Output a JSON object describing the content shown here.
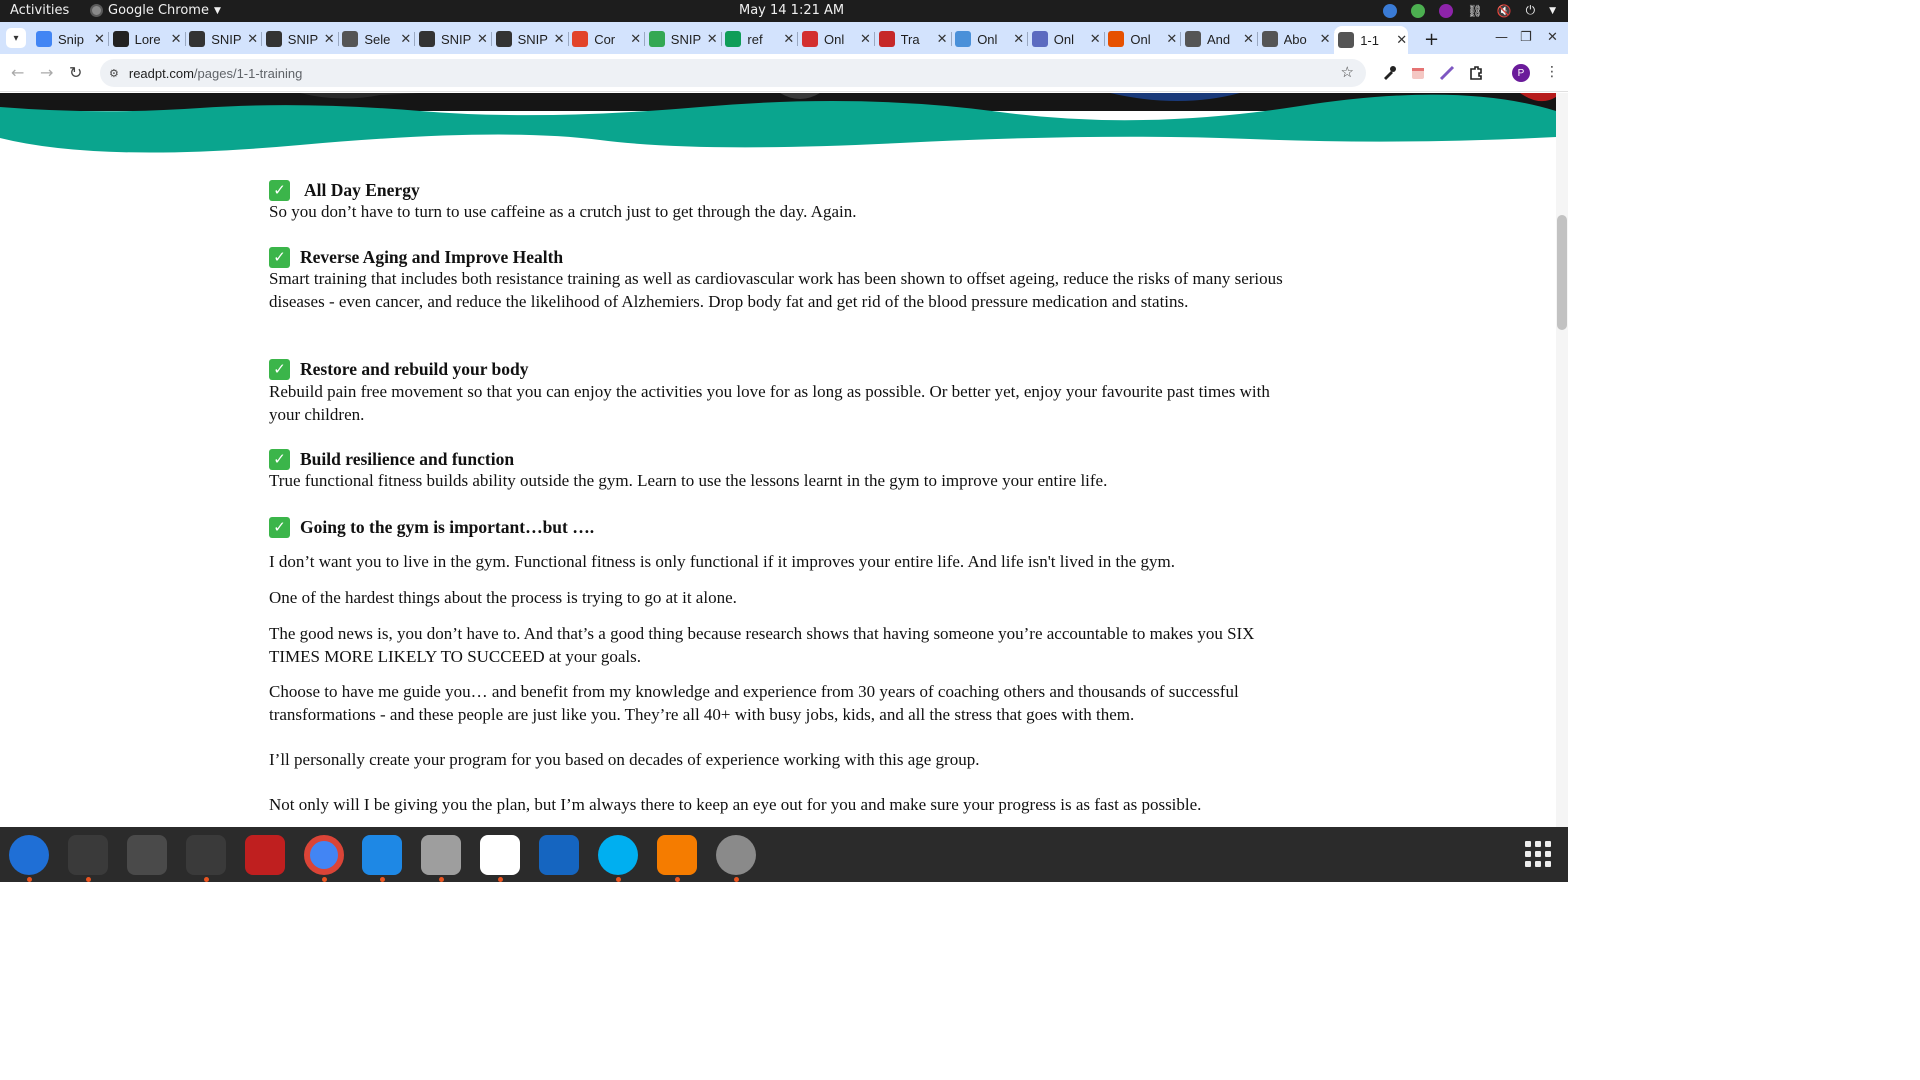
{
  "system_bar": {
    "activities": "Activities",
    "app_name": "Google Chrome",
    "clock": "May 14  1:21 AM"
  },
  "tabs": [
    {
      "title": "Snip",
      "favicon": "google-docs-icon",
      "color": "#4285f4"
    },
    {
      "title": "Lore",
      "favicon": "letter-l-icon",
      "color": "#222222"
    },
    {
      "title": "SNIP",
      "favicon": "snip-logo-icon",
      "color": "#333333"
    },
    {
      "title": "SNIP",
      "favicon": "snip-logo-icon",
      "color": "#333333"
    },
    {
      "title": "Sele",
      "favicon": "globe-icon",
      "color": "#555555"
    },
    {
      "title": "SNIP",
      "favicon": "snip-logo-icon",
      "color": "#333333"
    },
    {
      "title": "SNIP",
      "favicon": "snip-logo-icon",
      "color": "#333333"
    },
    {
      "title": "Cor",
      "favicon": "gitlab-icon",
      "color": "#e24329"
    },
    {
      "title": "SNIP",
      "favicon": "colorful-logo-icon",
      "color": "#34a853"
    },
    {
      "title": "ref",
      "favicon": "plus-sheet-icon",
      "color": "#0f9d58"
    },
    {
      "title": "Onl",
      "favicon": "red-logo-icon",
      "color": "#d32f2f"
    },
    {
      "title": "Tra",
      "favicon": "red-logo-icon",
      "color": "#c62828"
    },
    {
      "title": "Onl",
      "favicon": "w-logo-icon",
      "color": "#4a90d9"
    },
    {
      "title": "Onl",
      "favicon": "feather-logo-icon",
      "color": "#5c6bc0"
    },
    {
      "title": "Onl",
      "favicon": "chevron-logo-icon",
      "color": "#e65100"
    },
    {
      "title": "And",
      "favicon": "globe-icon",
      "color": "#555555"
    },
    {
      "title": "Abo",
      "favicon": "globe-icon",
      "color": "#555555"
    },
    {
      "title": "1-1",
      "favicon": "globe-icon",
      "color": "#555555",
      "active": true
    }
  ],
  "toolbar": {
    "url_host": "readpt.com",
    "url_path": "/pages/1-1-training",
    "avatar_letter": "P"
  },
  "page": {
    "accent_color": "#0aa58e",
    "features": [
      {
        "title": "All Day Energy",
        "body": "So you don’t have to turn to use caffeine as a crutch just to get through the day. Again."
      },
      {
        "title": "Reverse Aging and Improve Health",
        "body": "Smart training that includes both resistance training as well as cardiovascular work has been shown to offset ageing, reduce the risks of many serious diseases  - even cancer, and reduce the likelihood of Alzhemiers. Drop body fat and get rid of the blood pressure medication and statins."
      },
      {
        "title": "Restore and rebuild your body",
        "body": "Rebuild pain free movement so that you can enjoy the activities you love for as long as possible. Or better yet, enjoy your favourite past times with your children."
      },
      {
        "title": "Build resilience and function",
        "body": "True functional fitness builds ability outside the gym. Learn to use the lessons learnt in the gym to improve your entire life."
      },
      {
        "title": "Going to the gym is important…but ….",
        "body": ""
      }
    ],
    "paragraphs": [
      "I don’t want you to live in the gym. Functional fitness is only functional if it improves your entire life. And life isn't lived in the gym.",
      "One of the hardest things about the process is trying to go at it alone.",
      "The good news is, you don’t have to. And that’s a good thing because research shows that having someone you’re accountable to makes you SIX TIMES MORE LIKELY TO SUCCEED at your goals.",
      "Choose to have me guide you… and benefit from my knowledge and experience from 30 years of coaching others and thousands of successful transformations - and these people are just like you. They’re all 40+ with busy jobs, kids, and all the stress that goes with them.",
      "I’ll personally create your program for you based on decades of experience working with this age group.",
      "Not only will I be giving you the plan, but I’m always there to keep an eye out for you and make sure your progress is as fast as possible."
    ]
  },
  "dock": [
    {
      "name": "thunderbird-icon",
      "color": "#1f6fd6"
    },
    {
      "name": "terminal-icon",
      "color": "#3a3a3a"
    },
    {
      "name": "calculator-icon",
      "color": "#4a4a4a"
    },
    {
      "name": "system-monitor-icon",
      "color": "#3a3a3a"
    },
    {
      "name": "filezilla-icon",
      "color": "#bf1f1f"
    },
    {
      "name": "chrome-icon",
      "color": "#4285f4"
    },
    {
      "name": "vscode-icon",
      "color": "#1e88e5"
    },
    {
      "name": "files-icon",
      "color": "#9e9e9e"
    },
    {
      "name": "text-editor-icon",
      "color": "#ffffff"
    },
    {
      "name": "libreoffice-writer-icon",
      "color": "#1565c0"
    },
    {
      "name": "skype-icon",
      "color": "#00aff0"
    },
    {
      "name": "blender-like-icon",
      "color": "#f57c00"
    },
    {
      "name": "disk-utility-icon",
      "color": "#8a8a8a"
    }
  ]
}
